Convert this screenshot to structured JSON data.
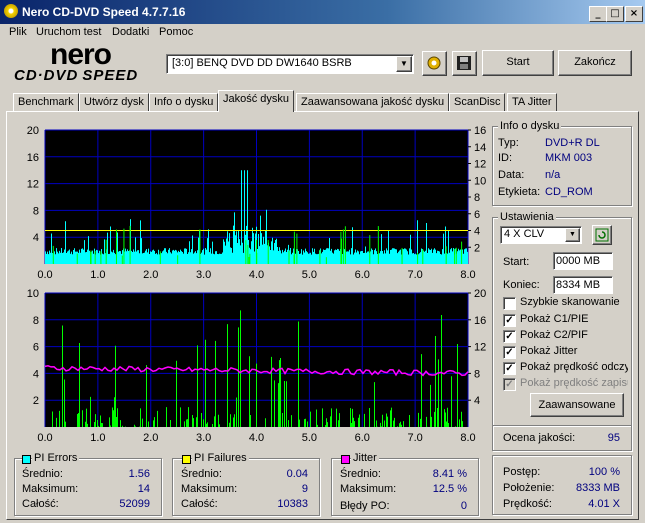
{
  "window": {
    "title": "Nero CD-DVD Speed 4.7.7.16"
  },
  "menu": [
    "Plik",
    "Uruchom test",
    "Dodatki",
    "Pomoc"
  ],
  "logo": {
    "top": "nero",
    "bottom": "CD·DVD SPEED"
  },
  "drive": {
    "selected": "[3:0]   BENQ DVD DD DW1640 BSRB"
  },
  "toolbar": {
    "start": "Start",
    "exit": "Zakończ"
  },
  "tabs": [
    "Benchmark",
    "Utwórz dysk",
    "Info o dysku",
    "Jakość dysku",
    "Zaawansowana jakość dysku",
    "ScanDisc",
    "TA Jitter"
  ],
  "active_tab": "Jakość dysku",
  "disc_info": {
    "title": "Info o dysku",
    "rows": [
      {
        "label": "Typ:",
        "value": "DVD+R DL"
      },
      {
        "label": "ID:",
        "value": "MKM 003"
      },
      {
        "label": "Data:",
        "value": "n/a"
      },
      {
        "label": "Etykieta:",
        "value": "CD_ROM"
      }
    ]
  },
  "settings": {
    "title": "Ustawienia",
    "speed": "4 X CLV",
    "start_label": "Start:",
    "start_value": "0000 MB",
    "end_label": "Koniec:",
    "end_value": "8334 MB",
    "checks": [
      {
        "label": "Szybkie skanowanie",
        "checked": false,
        "disabled": false
      },
      {
        "label": "Pokaż C1/PIE",
        "checked": true,
        "disabled": false
      },
      {
        "label": "Pokaż C2/PIF",
        "checked": true,
        "disabled": false
      },
      {
        "label": "Pokaż Jitter",
        "checked": true,
        "disabled": false
      },
      {
        "label": "Pokaż prędkość odczytu",
        "checked": true,
        "disabled": false
      },
      {
        "label": "Pokaż prędkość zapisu",
        "checked": true,
        "disabled": true
      }
    ],
    "advanced": "Zaawansowane"
  },
  "quality": {
    "label": "Ocena jakości:",
    "value": "95"
  },
  "progress": {
    "rows": [
      {
        "label": "Postęp:",
        "value": "100 %"
      },
      {
        "label": "Położenie:",
        "value": "8333 MB"
      },
      {
        "label": "Prędkość:",
        "value": "4.01 X"
      }
    ]
  },
  "stats": {
    "pi_errors": {
      "title": "PI Errors",
      "color": "#00ffff",
      "rows": [
        {
          "label": "Średnio:",
          "value": "1.56"
        },
        {
          "label": "Maksimum:",
          "value": "14"
        },
        {
          "label": "Całość:",
          "value": "52099"
        }
      ]
    },
    "pi_failures": {
      "title": "PI Failures",
      "color": "#ffff00",
      "rows": [
        {
          "label": "Średnio:",
          "value": "0.04"
        },
        {
          "label": "Maksimum:",
          "value": "9"
        },
        {
          "label": "Całość:",
          "value": "10383"
        }
      ]
    },
    "jitter": {
      "title": "Jitter",
      "color": "#ff00ff",
      "rows": [
        {
          "label": "Średnio:",
          "value": "8.41 %"
        },
        {
          "label": "Maksimum:",
          "value": "12.5 %"
        },
        {
          "label": "Błędy PO:",
          "value": "0"
        }
      ]
    }
  },
  "chart_data": [
    {
      "type": "bar",
      "name": "PI Errors",
      "color": "#00ffff",
      "x_ticks": [
        "0.0",
        "1.0",
        "2.0",
        "3.0",
        "4.0",
        "5.0",
        "6.0",
        "7.0",
        "8.0"
      ],
      "xlim": [
        0,
        8
      ],
      "left_ticks": [
        "20",
        "16",
        "12",
        "8",
        "4"
      ],
      "ylim": [
        0,
        20
      ],
      "right_ticks": [
        "16",
        "14",
        "12",
        "10",
        "8",
        "6",
        "4",
        "2"
      ],
      "right_lim": [
        0,
        16
      ],
      "avg": 1.56,
      "max": 14,
      "read_speed": 4.0,
      "read_speed_color": "#ffff00"
    },
    {
      "type": "bar",
      "name": "PI Failures / Jitter",
      "color": "#00ff00",
      "x_ticks": [
        "0.0",
        "1.0",
        "2.0",
        "3.0",
        "4.0",
        "5.0",
        "6.0",
        "7.0",
        "8.0"
      ],
      "xlim": [
        0,
        8
      ],
      "left_ticks": [
        "10",
        "8",
        "6",
        "4",
        "2"
      ],
      "ylim": [
        0,
        10
      ],
      "right_ticks": [
        "20",
        "16",
        "12",
        "8",
        "4"
      ],
      "right_lim": [
        0,
        20
      ],
      "max": 9,
      "jitter_color": "#ff00ff",
      "jitter_avg": 8.41,
      "jitter_max": 12.5
    }
  ]
}
